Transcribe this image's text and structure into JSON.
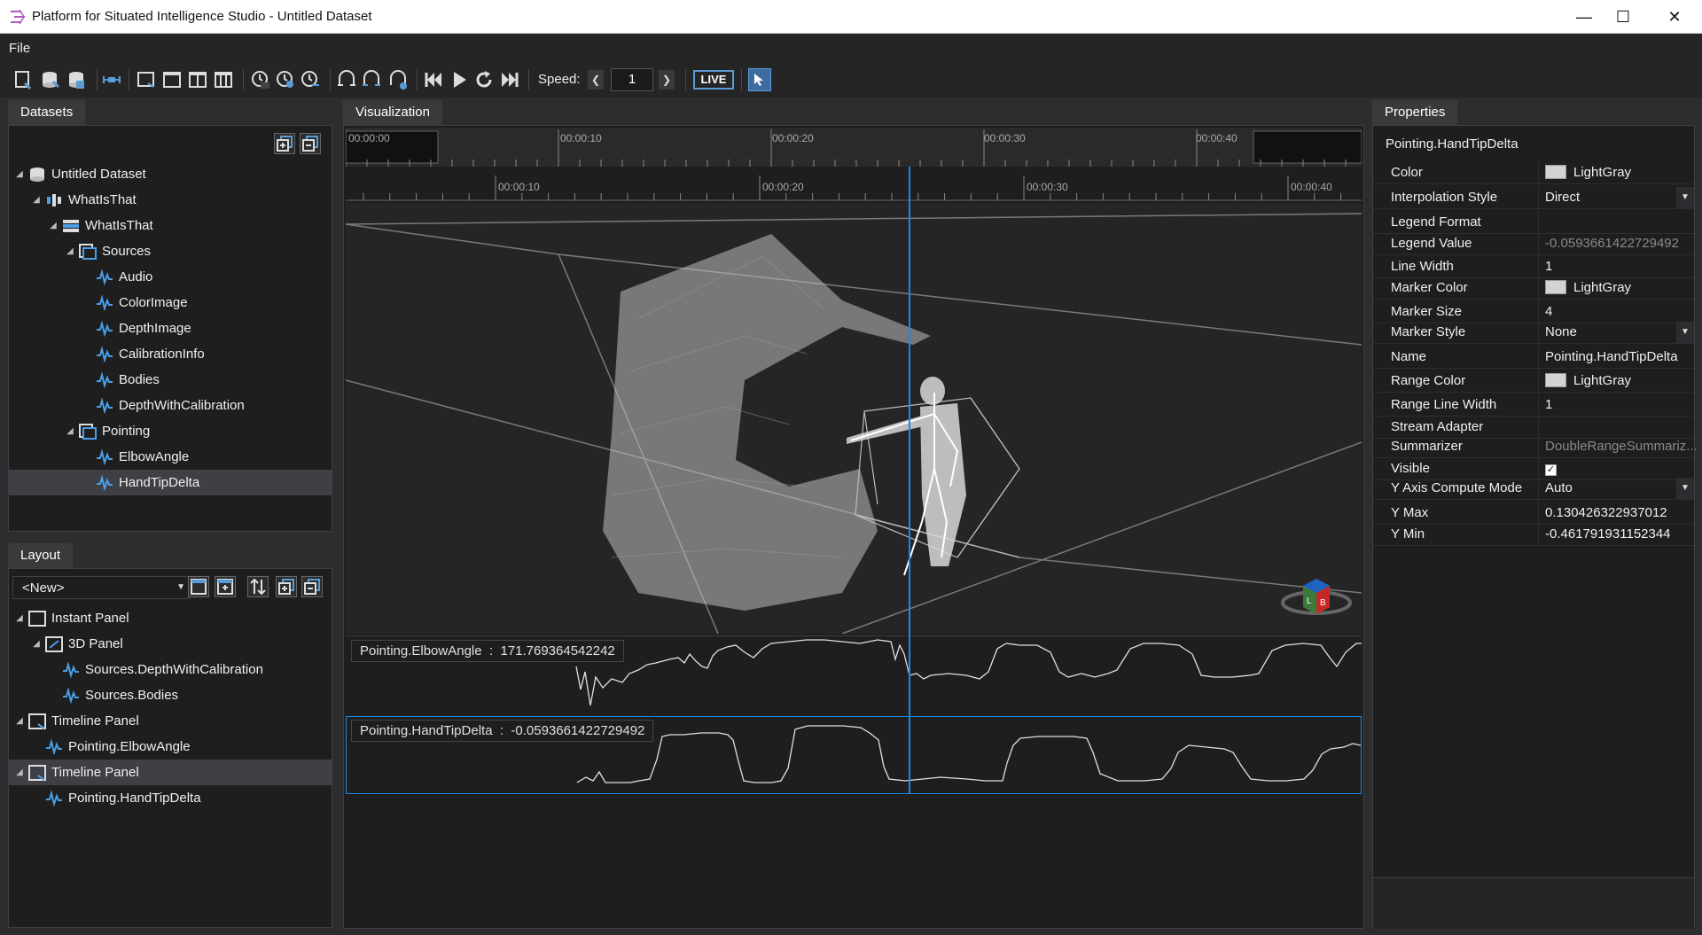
{
  "window": {
    "title": "Platform for Situated Intelligence Studio - Untitled Dataset",
    "minimize": "—",
    "maximize": "☐",
    "close": "✕"
  },
  "menu": {
    "file": "File"
  },
  "toolbar": {
    "speed_label": "Speed:",
    "speed_value": "1",
    "live_label": "LIVE"
  },
  "datasets": {
    "tab": "Datasets",
    "tree": [
      {
        "label": "Untitled Dataset",
        "level": 0,
        "icon": "database-icon",
        "expanded": true
      },
      {
        "label": "WhatIsThat",
        "level": 1,
        "icon": "session-icon",
        "expanded": true
      },
      {
        "label": "WhatIsThat",
        "level": 2,
        "icon": "partition-icon",
        "expanded": true
      },
      {
        "label": "Sources",
        "level": 3,
        "icon": "folder-icon",
        "expanded": true
      },
      {
        "label": "Audio",
        "level": 4,
        "icon": "audio-stream-icon"
      },
      {
        "label": "ColorImage",
        "level": 4,
        "icon": "stream-icon"
      },
      {
        "label": "DepthImage",
        "level": 4,
        "icon": "stream-icon"
      },
      {
        "label": "CalibrationInfo",
        "level": 4,
        "icon": "stream-icon"
      },
      {
        "label": "Bodies",
        "level": 4,
        "icon": "stream-icon"
      },
      {
        "label": "DepthWithCalibration",
        "level": 4,
        "icon": "stream-icon"
      },
      {
        "label": "Pointing",
        "level": 3,
        "icon": "folder-icon",
        "expanded": true
      },
      {
        "label": "ElbowAngle",
        "level": 4,
        "icon": "stream-icon"
      },
      {
        "label": "HandTipDelta",
        "level": 4,
        "icon": "stream-icon",
        "selected": true
      }
    ]
  },
  "layout": {
    "tab": "Layout",
    "selector_value": "<New>",
    "tree": [
      {
        "label": "Instant Panel",
        "level": 0,
        "icon": "panel-icon",
        "expanded": true
      },
      {
        "label": "3D Panel",
        "level": 1,
        "icon": "3d-panel-icon",
        "expanded": true
      },
      {
        "label": "Sources.DepthWithCalibration",
        "level": 2,
        "icon": "stream-icon"
      },
      {
        "label": "Sources.Bodies",
        "level": 2,
        "icon": "stream-icon"
      },
      {
        "label": "Timeline Panel",
        "level": 0,
        "icon": "timeline-panel-icon",
        "expanded": true
      },
      {
        "label": "Pointing.ElbowAngle",
        "level": 1,
        "icon": "stream-icon"
      },
      {
        "label": "Timeline Panel",
        "level": 0,
        "icon": "timeline-panel-icon",
        "expanded": true,
        "selected": true
      },
      {
        "label": "Pointing.HandTipDelta",
        "level": 1,
        "icon": "stream-icon"
      }
    ]
  },
  "visualization": {
    "tab": "Visualization",
    "navigator_ticks": [
      "00:00:00",
      "00:00:10",
      "00:00:20",
      "00:00:30",
      "00:00:40"
    ],
    "timeline_ticks": [
      "00:00:10",
      "00:00:20",
      "00:00:30",
      "00:00:40"
    ],
    "elbow_legend": {
      "name": "Pointing.ElbowAngle",
      "sep": ":",
      "value": "171.769364542242"
    },
    "handtip_legend": {
      "name": "Pointing.HandTipDelta",
      "sep": ":",
      "value": "-0.0593661422729492"
    }
  },
  "properties": {
    "tab": "Properties",
    "header": "Pointing.HandTipDelta",
    "rows": [
      {
        "name": "Color",
        "value": "LightGray",
        "swatch": "#d3d3d3"
      },
      {
        "name": "Interpolation Style",
        "value": "Direct",
        "dropdown": true
      },
      {
        "name": "Legend Format",
        "value": ""
      },
      {
        "name": "Legend Value",
        "value": "-0.0593661422729492",
        "dim": true
      },
      {
        "name": "Line Width",
        "value": "1"
      },
      {
        "name": "Marker Color",
        "value": "LightGray",
        "swatch": "#d3d3d3"
      },
      {
        "name": "Marker Size",
        "value": "4"
      },
      {
        "name": "Marker Style",
        "value": "None",
        "dropdown": true
      },
      {
        "name": "Name",
        "value": "Pointing.HandTipDelta"
      },
      {
        "name": "Range Color",
        "value": "LightGray",
        "swatch": "#d3d3d3"
      },
      {
        "name": "Range Line Width",
        "value": "1"
      },
      {
        "name": "Stream Adapter",
        "value": ""
      },
      {
        "name": "Summarizer",
        "value": "DoubleRangeSummariz...",
        "dim": true
      },
      {
        "name": "Visible",
        "value": "✓",
        "checkbox": true
      },
      {
        "name": "Y Axis Compute Mode",
        "value": "Auto",
        "dropdown": true
      },
      {
        "name": "Y Max",
        "value": "0.130426322937012"
      },
      {
        "name": "Y Min",
        "value": "-0.461791931152344"
      }
    ]
  },
  "colors": {
    "accent": "#1e88e5",
    "panel_bg": "#1e1e1e",
    "chrome_bg": "#252526",
    "plot_line": "#e0e0e0"
  }
}
